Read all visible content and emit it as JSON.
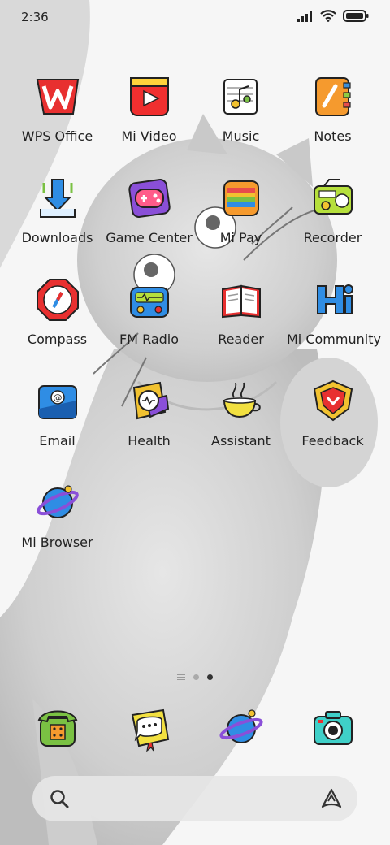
{
  "status_bar": {
    "time": "2:36",
    "icons": [
      "signal-icon",
      "wifi-icon",
      "battery-icon"
    ]
  },
  "apps": [
    {
      "label": "WPS Office",
      "icon": "wps-office-icon"
    },
    {
      "label": "Mi Video",
      "icon": "mi-video-icon"
    },
    {
      "label": "Music",
      "icon": "music-icon"
    },
    {
      "label": "Notes",
      "icon": "notes-icon"
    },
    {
      "label": "Downloads",
      "icon": "downloads-icon"
    },
    {
      "label": "Game Center",
      "icon": "game-center-icon"
    },
    {
      "label": "Mi Pay",
      "icon": "mi-pay-icon"
    },
    {
      "label": "Recorder",
      "icon": "recorder-icon"
    },
    {
      "label": "Compass",
      "icon": "compass-icon"
    },
    {
      "label": "FM Radio",
      "icon": "fm-radio-icon"
    },
    {
      "label": "Reader",
      "icon": "reader-icon"
    },
    {
      "label": "Mi Community",
      "icon": "mi-community-icon"
    },
    {
      "label": "Email",
      "icon": "email-icon"
    },
    {
      "label": "Health",
      "icon": "health-icon"
    },
    {
      "label": "Assistant",
      "icon": "assistant-icon"
    },
    {
      "label": "Feedback",
      "icon": "feedback-icon"
    },
    {
      "label": "Mi Browser",
      "icon": "mi-browser-icon"
    }
  ],
  "page_indicator": {
    "pages": 2,
    "active": 2
  },
  "dock": [
    {
      "icon": "phone-icon"
    },
    {
      "icon": "messages-icon"
    },
    {
      "icon": "browser-icon"
    },
    {
      "icon": "camera-icon"
    }
  ],
  "search_bar": {
    "icons": [
      "search-icon",
      "assistant-a-icon"
    ]
  }
}
